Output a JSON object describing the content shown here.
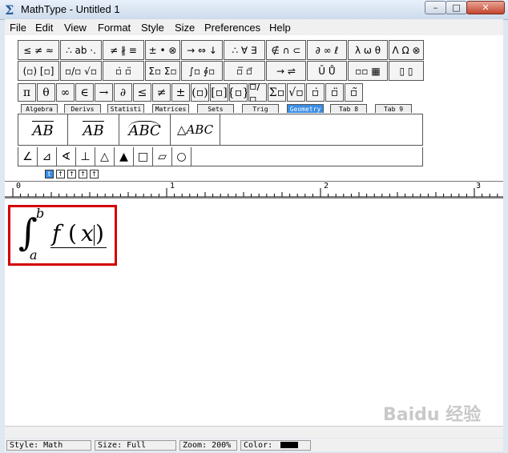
{
  "window": {
    "title": "MathType - Untitled 1",
    "app_icon": "Σ"
  },
  "menubar": [
    "File",
    "Edit",
    "View",
    "Format",
    "Style",
    "Size",
    "Preferences",
    "Help"
  ],
  "palette_row1": [
    "≤ ≠ ≈",
    "∴ ab ·.",
    "≠ ∦ ≡",
    "± • ⊗",
    "→ ⇔ ↓",
    "∴ ∀ ∃",
    "∉ ∩ ⊂",
    "∂ ∞ ℓ",
    "λ ω θ",
    "Λ Ω ⊗"
  ],
  "palette_row2": [
    "(▫) [▫]",
    "▫/▫ √▫",
    "▫̇ ▫̈",
    "Σ▫ Σ▫",
    "∫▫ ∮▫",
    "▫̅ ▫⃗",
    "→ ⇌",
    "Ū Ů",
    "▫▫ ▦",
    "▯ ▯"
  ],
  "palette_row3": [
    "π",
    "θ",
    "∞",
    "∈",
    "→",
    "∂",
    "≤",
    "≠",
    "±",
    "(▫)",
    "[▫]",
    "{▫}",
    "▫/▫",
    "Σ▫",
    "√▫",
    "▫̇",
    "▫̈",
    "▫̃"
  ],
  "tabs": [
    "Algebra",
    "Derivs",
    "Statisti",
    "Matrices",
    "Sets",
    "Trig",
    "Geometry",
    "Tab 8",
    "Tab 9"
  ],
  "active_tab": "Geometry",
  "templates": [
    "AB",
    "AB",
    "ABC",
    "△ABC"
  ],
  "shapes": [
    "∠",
    "⊿",
    "∢",
    "⊥",
    "△",
    "▲",
    "□",
    "▱",
    "○"
  ],
  "tabstops": [
    "t",
    "↑",
    "↑",
    "↑",
    "↑"
  ],
  "ruler": [
    "0",
    "1",
    "2",
    "3"
  ],
  "equation": {
    "lower": "a",
    "upper": "b",
    "integrand": "f",
    "open": "(",
    "var": "x",
    "close": ")"
  },
  "status": {
    "style": "Style: Math",
    "size": "Size: Full",
    "zoom": "Zoom: 200%",
    "color": "Color:"
  },
  "watermark": "Baidu 经验"
}
